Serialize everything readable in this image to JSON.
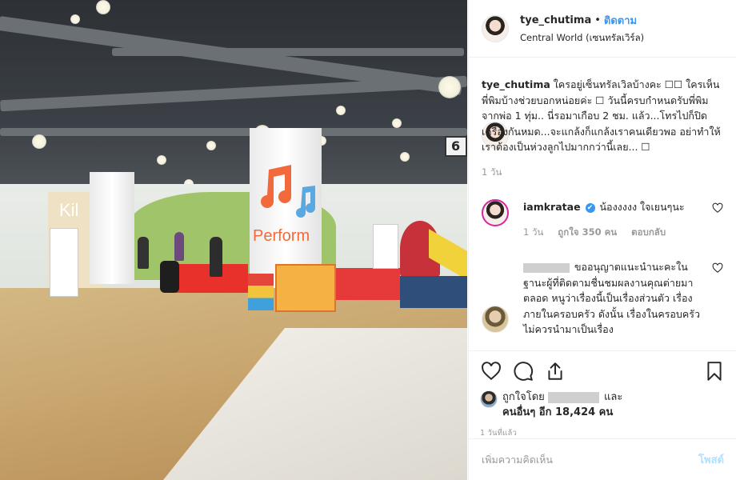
{
  "post": {
    "username": "tye_chutima",
    "separator": "•",
    "follow_label": "ติดตาม",
    "location": "Central World (เซนทรัลเวิร์ล)"
  },
  "photo": {
    "signage": [
      "Kil",
      "Perform",
      "6"
    ]
  },
  "caption": {
    "username": "tye_chutima",
    "text": "ใครอยู่เซ็นทรัลเวิลบ้างคะ ☐☐ ใครเห็นพี่พิมบ้างช่วยบอกหน่อยค่ะ ☐ วันนี้ครบกำหนดรับพี่พิมจากพ่อ 1 ทุ่ม.. นี่รอมาเกือบ 2 ชม. แล้ว...โทรไปก็ปิดเครื่องกันหมด...จะแกล้งก็แกล้งเราคนเดียวพอ อย่าทำให้เราต้องเป็นห่วงลูกไปมากกว่านี้เลย... ☐",
    "time": "1 วัน"
  },
  "comments": [
    {
      "username": "iamkratae",
      "verified": "✔",
      "text": "น้องงงงง ใจเยนๆนะ",
      "time": "1 วัน",
      "likes": "ถูกใจ 350 คน",
      "reply": "ตอบกลับ"
    },
    {
      "username": "",
      "text": "ขออนุญาตแนะนำนะคะในฐานะผู้ที่ติดตามชื่นชมผลงานคุณต่ายมาตลอด หนูว่าเรื่องนี้เป็นเรื่องส่วนตัว เรื่องภายในครอบครัว ดังนั้น เรื่องในครอบครัวไม่ควรนำมาเป็นเรื่อง"
    }
  ],
  "likes": {
    "prefix": "ถูกใจโดย",
    "and": "และ",
    "others": "คนอื่นๆ อีก 18,424 คน"
  },
  "posted_time": "1 วันที่แล้ว",
  "add_comment": {
    "placeholder": "เพิ่มความคิดเห็น",
    "post_label": "โพสต์"
  },
  "colors": {
    "link_blue": "#3897f0",
    "post_disabled": "#b2dffc",
    "muted": "#999999"
  }
}
